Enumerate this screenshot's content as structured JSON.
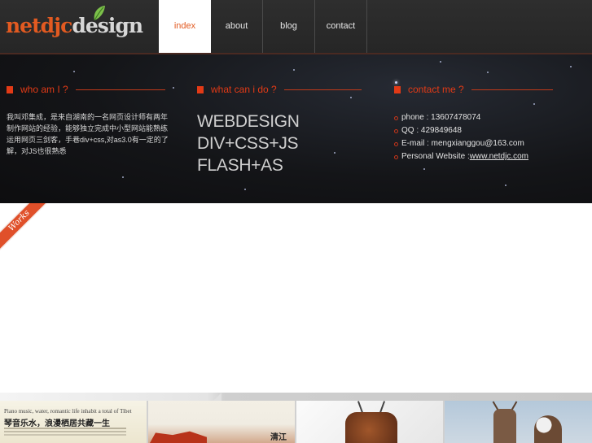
{
  "header": {
    "logo_part1": "netdjc",
    "logo_part2": "design",
    "nav": [
      {
        "label": "index",
        "active": true
      },
      {
        "label": "about",
        "active": false
      },
      {
        "label": "blog",
        "active": false
      },
      {
        "label": "contact",
        "active": false
      }
    ]
  },
  "who": {
    "title": "who am I ?",
    "text": "我叫邓集成，是来自湖南的一名网页设计师有两年制作网站的经验，能够独立完成中小型网站能熟练运用网页三剑客，手巷div+css,对as3.0有一定的了解，对JS也很熟悉"
  },
  "what": {
    "title": "what can i do ?",
    "skills": [
      "WEBDESIGN",
      "DIV+CSS+JS",
      "FLASH+AS"
    ]
  },
  "contact": {
    "title": "contact me ?",
    "phone": "phone : 13607478074",
    "qq": "QQ : 429849648",
    "email": "E-mail : mengxianggou@163.com",
    "website_label": "Personal Website :",
    "website_url": "www.netdjc.com"
  },
  "works_label": "Works",
  "thumbs": {
    "t1_caption": "Piano music, water, romantic life inhabit a total of Tibet",
    "t1_title": "琴音乐水，浪漫栖居共藏一生",
    "t2_title": "清江"
  },
  "colors": {
    "accent": "#e25a21",
    "header_bg": "#2b2b2b",
    "band_bg": "#141518"
  }
}
